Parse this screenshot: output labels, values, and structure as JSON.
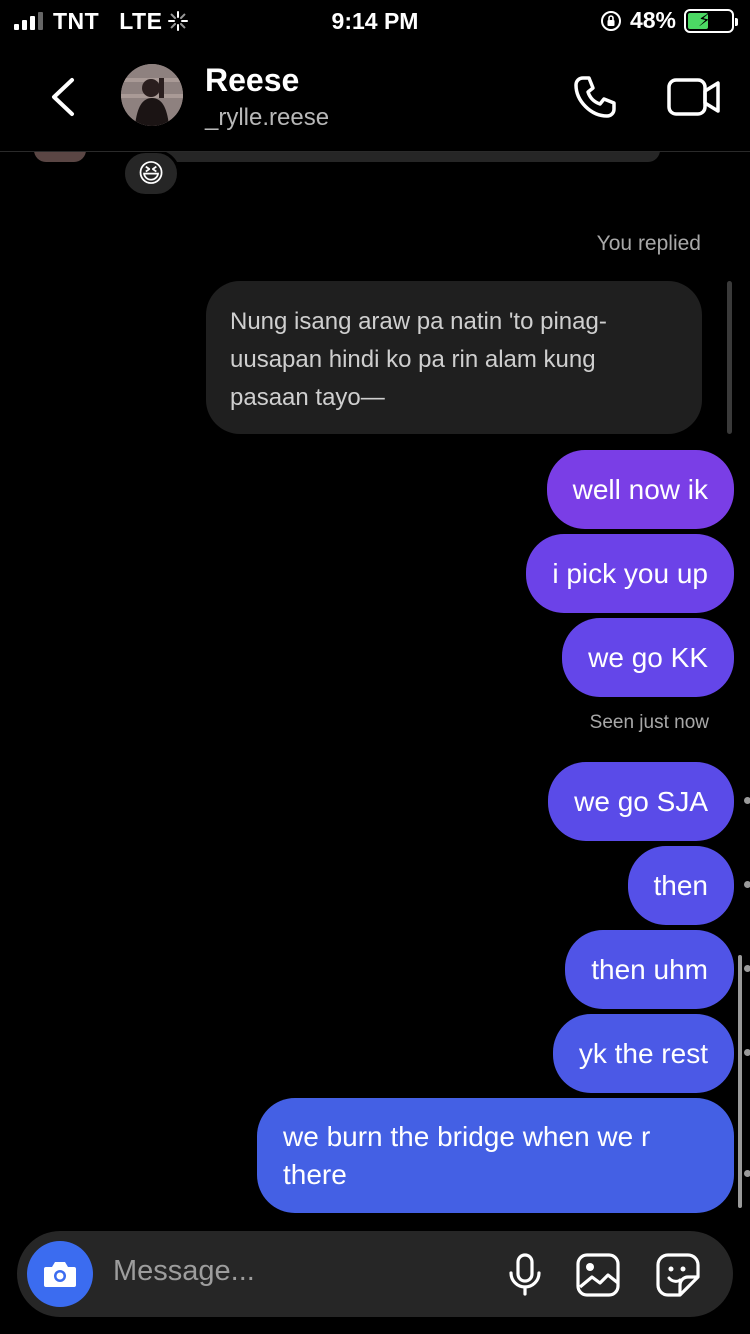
{
  "status_bar": {
    "carrier": "TNT",
    "network": "LTE",
    "time": "9:14 PM",
    "battery": "48%",
    "battery_level": 0.48
  },
  "header": {
    "name": "Reese",
    "username": "_rylle.reese",
    "icons": [
      "back-chevron-icon",
      "phone-icon",
      "video-camera-icon"
    ]
  },
  "previous": {
    "reaction": "😆"
  },
  "reply": {
    "label": "You replied",
    "quoted_text": "Nung isang araw pa natin 'to pinag-uusapan hindi ko pa rin alam kung pasaan tayo—"
  },
  "messages": [
    {
      "text": "well now ik",
      "color": "#7a3ee6"
    },
    {
      "text": "i pick you up",
      "color": "#6c42e8"
    },
    {
      "text": "we go KK",
      "color": "#6446e9"
    },
    {
      "text": "we go SJA",
      "color": "#5a4be8"
    },
    {
      "text": "then",
      "color": "#5550e8"
    },
    {
      "text": "then uhm",
      "color": "#5054e7"
    },
    {
      "text": "yk the rest",
      "color": "#4b59e6"
    },
    {
      "text": "we burn the bridge when we r there",
      "color": "#4460e4"
    }
  ],
  "seen_label": "Seen just now",
  "composer": {
    "placeholder": "Message...",
    "camera_color": "#3b6cf0"
  }
}
